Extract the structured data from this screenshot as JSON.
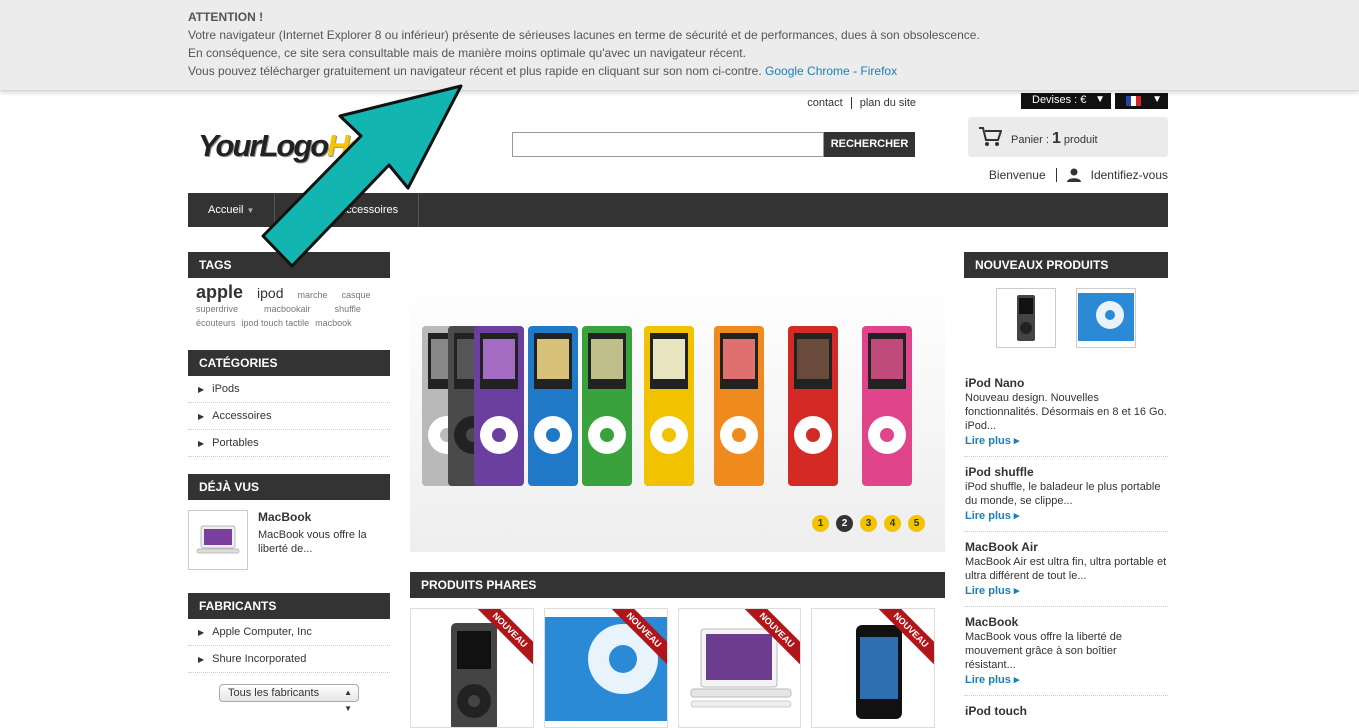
{
  "warning": {
    "title": "ATTENTION !",
    "line1": "Votre navigateur (Internet Explorer 8 ou inférieur) présente de sérieuses lacunes en terme de sécurité et de performances, dues à son obsolescence.",
    "line2": "En conséquence, ce site sera consultable mais de manière moins optimale qu'avec un navigateur récent.",
    "line3": "Vous pouvez télécharger gratuitement un navigateur récent et plus rapide en cliquant sur son nom ci-contre. ",
    "chrome": "Google Chrome",
    "dash": " - ",
    "firefox": "Firefox"
  },
  "header": {
    "contact": "contact",
    "sitemap": "plan du site",
    "currency": "Devises : €",
    "logo_main": "YourLogo",
    "logo_accent": "He",
    "search_button": "RECHERCHER",
    "search_value": "",
    "cart_label": "Panier : ",
    "cart_count": "1",
    "cart_unit": " produit",
    "welcome": "Bienvenue",
    "login": "Identifiez-vous"
  },
  "nav": {
    "home": "Accueil",
    "item2": "i",
    "accessories": "Accessoires"
  },
  "tags": {
    "title": "TAGS",
    "items": [
      "apple",
      "ipod",
      "marche",
      "casque",
      "superdrive",
      "macbookair",
      "shuffle",
      "écouteurs",
      "ipod touch tactile",
      "macbook"
    ]
  },
  "categories": {
    "title": "CATÉGORIES",
    "items": [
      "iPods",
      "Accessoires",
      "Portables"
    ]
  },
  "viewed": {
    "title": "DÉJÀ VUS",
    "name": "MacBook",
    "desc": "MacBook vous offre la liberté de..."
  },
  "manufacturers": {
    "title": "FABRICANTS",
    "items": [
      "Apple Computer, Inc",
      "Shure Incorporated"
    ],
    "select": "Tous les fabricants"
  },
  "slider": {
    "dots": [
      "1",
      "2",
      "3",
      "4",
      "5"
    ],
    "active": 2
  },
  "featured": {
    "title": "PRODUITS PHARES",
    "badge": "NOUVEAU"
  },
  "new_products": {
    "title": "NOUVEAUX PRODUITS",
    "more": "Lire plus",
    "items": [
      {
        "name": "iPod Nano",
        "desc": "Nouveau design. Nouvelles fonctionnalités. Désormais en 8 et 16 Go. iPod..."
      },
      {
        "name": "iPod shuffle",
        "desc": "iPod shuffle, le baladeur le plus portable du monde, se clippe..."
      },
      {
        "name": "MacBook Air",
        "desc": "MacBook Air est ultra fin, ultra portable et ultra différent de tout le..."
      },
      {
        "name": "MacBook",
        "desc": "MacBook vous offre la liberté de mouvement grâce à son boîtier résistant..."
      },
      {
        "name": "iPod touch",
        "desc": ""
      }
    ]
  },
  "colors": {
    "accent_link": "#1b7fb9",
    "arrow": "#13b5b1",
    "nav_bg": "#333333",
    "dot": "#f2c300"
  }
}
